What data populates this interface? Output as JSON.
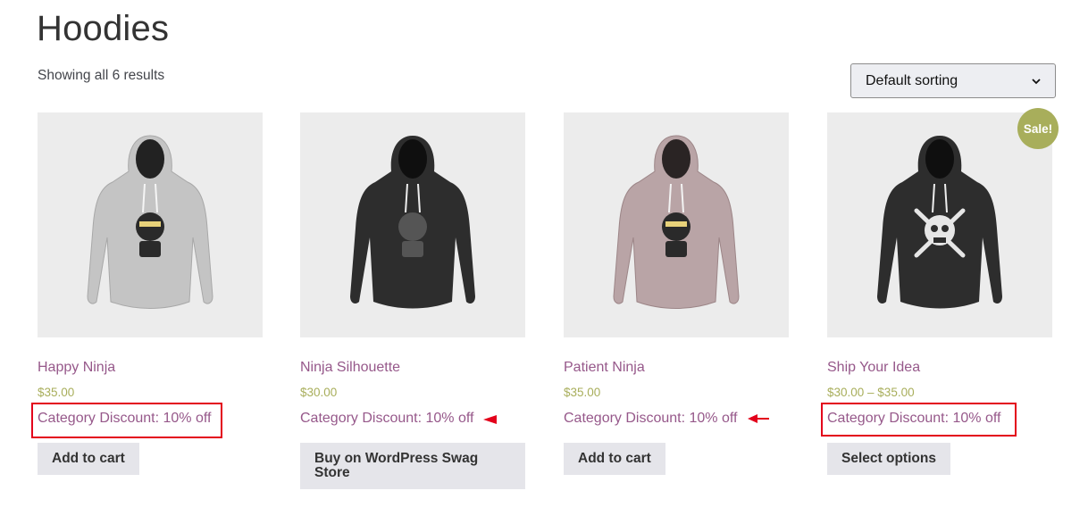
{
  "page": {
    "title": "Hoodies",
    "result_count": "Showing all 6 results"
  },
  "sorting": {
    "selected": "Default sorting"
  },
  "products": [
    {
      "name": "Happy Ninja",
      "price": "$35.00",
      "discount": "Category Discount: 10% off",
      "button": "Add to cart",
      "hoodie_color": "#c4c4c4"
    },
    {
      "name": "Ninja Silhouette",
      "price": "$30.00",
      "discount": "Category Discount: 10% off",
      "button": "Buy on WordPress Swag Store",
      "hoodie_color": "#2d2d2d"
    },
    {
      "name": "Patient Ninja",
      "price": "$35.00",
      "discount": "Category Discount: 10% off",
      "button": "Add to cart",
      "hoodie_color": "#b9a4a6"
    },
    {
      "name": "Ship Your Idea",
      "price": "$30.00 – $35.00",
      "discount": "Category Discount: 10% off",
      "button": "Select options",
      "hoodie_color": "#2d2d2d",
      "badge": "Sale!"
    }
  ],
  "colors": {
    "link": "#96588a",
    "price": "#a8ae5b",
    "annotation": "#e3001b",
    "button_bg": "#e5e5ea"
  }
}
